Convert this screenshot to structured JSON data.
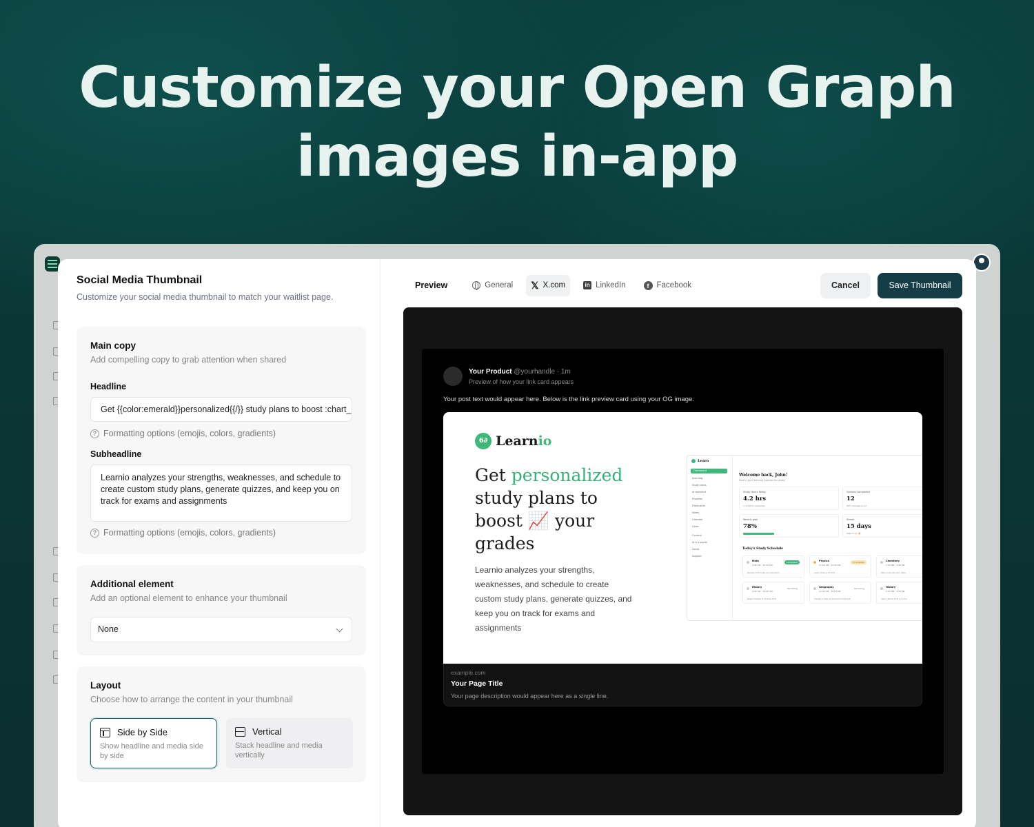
{
  "hero": {
    "line1": "Customize your Open Graph",
    "line2": "images in-app"
  },
  "modal": {
    "title": "Social Media Thumbnail",
    "description": "Customize your social media thumbnail to match your waitlist page.",
    "main_copy": {
      "title": "Main copy",
      "description": "Add compelling copy to grab attention when shared",
      "headline_label": "Headline",
      "headline_value": "Get {{color:emerald}}personalized{{/}} study plans to boost :chart_increasing: your grades",
      "formatting_help": "Formatting options (emojis, colors, gradients)",
      "subheadline_label": "Subheadline",
      "subheadline_value": "Learnio analyzes your strengths, weaknesses, and schedule to create custom study plans, generate quizzes, and keep you on track for exams and assignments"
    },
    "additional": {
      "title": "Additional element",
      "description": "Add an optional element to enhance your thumbnail",
      "selected": "None"
    },
    "layout": {
      "title": "Layout",
      "description": "Choose how to arrange the content in your thumbnail",
      "options": [
        {
          "label": "Side by Side",
          "description": "Show headline and media side by side",
          "selected": true
        },
        {
          "label": "Vertical",
          "description": "Stack headline and media vertically",
          "selected": false
        }
      ]
    },
    "preview": {
      "heading": "Preview",
      "tabs": [
        "General",
        "X.com",
        "LinkedIn",
        "Facebook"
      ],
      "active_tab": "X.com",
      "cancel_label": "Cancel",
      "save_label": "Save Thumbnail"
    },
    "tweet": {
      "name": "Your Product",
      "handle": "@yourhandle · 1m",
      "sub": "Preview of how your link card appears",
      "text": "Your post text would appear here. Below is the link preview card using your OG image.",
      "domain": "example.com",
      "page_title": "Your Page Title",
      "page_desc": "Your page description would appear here as a single line."
    },
    "og": {
      "brand_a": "Learn",
      "brand_b": "io",
      "h_pre": "Get ",
      "h_em": "personalized",
      "h_post": " study plans to boost 📈 your grades",
      "body": "Learnio analyzes your strengths, weaknesses, and schedule to create custom study plans, generate quizzes, and keep you on track for exams and assignments",
      "accent": "#35b07a"
    },
    "dashboard": {
      "welcome": "Welcome back, John!",
      "welcome_sub": "Here's your learning process for today",
      "stats": [
        {
          "label": "Study Hours Today",
          "value": "4.2 hrs",
          "sub": "+ 0.5 from yesterday"
        },
        {
          "label": "Quizzes Completed",
          "value": "12",
          "sub": "85% average score"
        },
        {
          "label": "Weekly goal",
          "value": "78%",
          "sub": ""
        },
        {
          "label": "Streak",
          "value": "15 days",
          "sub": "Keep it up! 🔥"
        }
      ],
      "schedule_title": "Today's Study Schedule",
      "events": [
        {
          "subject": "Math",
          "time": "9:00 AM - 10:30 AM",
          "note": "Review fl formula and equation",
          "status": "Completed"
        },
        {
          "subject": "Physics",
          "time": "11:00 AM - 12:30 AM",
          "note": "Learn theory of XYZ",
          "status": "In progress"
        },
        {
          "subject": "Chemistry",
          "time": "2:00 PM - 3:30 PM",
          "note": "Memorize periodic table",
          "status": ""
        },
        {
          "subject": "History",
          "time": "9:00 AM - 10:30 AM",
          "note": "Read chapter 5 of book XYZ",
          "status": "Upcoming"
        },
        {
          "subject": "Geography",
          "time": "11:00 AM - 12:00 AM",
          "note": "Create a map of America continent",
          "status": "Upcoming"
        },
        {
          "subject": "History",
          "time": "2:00 PM - 3:30 PM",
          "note": "Learn about XYZ in X era",
          "status": ""
        }
      ],
      "nav": [
        "Dashboard",
        "Learning",
        "Study plans",
        "AI assistant",
        "Progress",
        "Flashcards",
        "Notes",
        "Calendar",
        "Goals",
        "Content",
        "AI & Insights",
        "Social",
        "Support"
      ]
    }
  }
}
